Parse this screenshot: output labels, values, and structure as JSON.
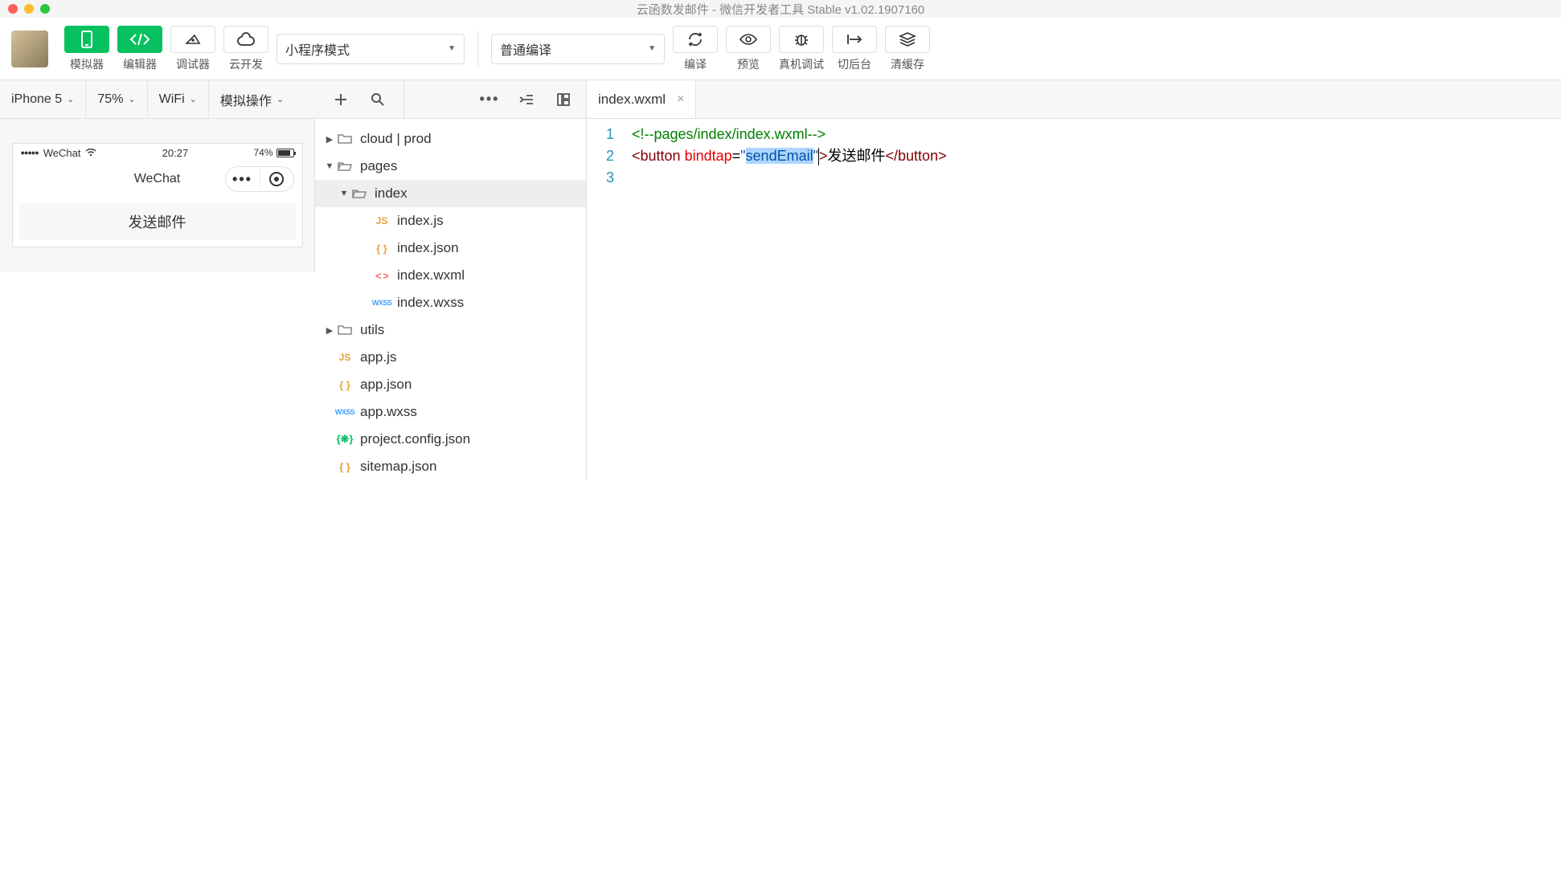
{
  "window": {
    "title": "云函数发邮件 - 微信开发者工具 Stable v1.02.1907160"
  },
  "toolbar": {
    "simulator": "模拟器",
    "editor": "编辑器",
    "debugger": "调试器",
    "cloud": "云开发",
    "mode": "小程序模式",
    "compile_mode": "普通编译",
    "compile": "编译",
    "preview": "预览",
    "remote_debug": "真机调试",
    "background": "切后台",
    "clear_cache": "清缓存"
  },
  "subbar": {
    "device": "iPhone 5",
    "zoom": "75%",
    "network": "WiFi",
    "sim_action": "模拟操作"
  },
  "editor_tab": {
    "filename": "index.wxml"
  },
  "simulator": {
    "carrier": "WeChat",
    "time": "20:27",
    "battery": "74%",
    "nav_title": "WeChat",
    "button_text": "发送邮件"
  },
  "tree": {
    "n0": "cloud | prod",
    "n1": "pages",
    "n2": "index",
    "n3": "index.js",
    "n4": "index.json",
    "n5": "index.wxml",
    "n6": "index.wxss",
    "n7": "utils",
    "n8": "app.js",
    "n9": "app.json",
    "n10": "app.wxss",
    "n11": "project.config.json",
    "n12": "sitemap.json"
  },
  "code": {
    "line1_comment": "<!--pages/index/index.wxml-->",
    "line2": {
      "tag_open": "button",
      "attr": "bindtap",
      "value": "sendEmail",
      "text": "发送邮件",
      "tag_close": "button"
    },
    "gutter": [
      "1",
      "2",
      "3"
    ]
  }
}
